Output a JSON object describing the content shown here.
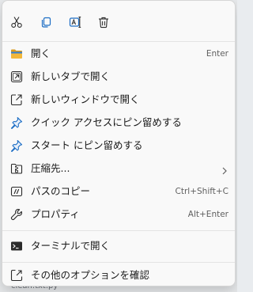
{
  "toolbar": {
    "cut_icon": "scissors-icon",
    "copy_icon": "copy-icon",
    "rename_icon": "rename-icon",
    "delete_icon": "trash-icon"
  },
  "items": [
    {
      "label": "開く",
      "shortcut": "Enter",
      "icon": "folder-icon"
    },
    {
      "label": "新しいタブで開く",
      "shortcut": "",
      "icon": "open-new-tab-icon"
    },
    {
      "label": "新しいウィンドウで開く",
      "shortcut": "",
      "icon": "open-new-window-icon"
    },
    {
      "label": "クイック アクセスにピン留めする",
      "shortcut": "",
      "icon": "pin-icon"
    },
    {
      "label": "スタート にピン留めする",
      "shortcut": "",
      "icon": "pin-icon"
    },
    {
      "label": "圧縮先...",
      "shortcut": "",
      "icon": "zip-folder-icon",
      "submenu": true
    },
    {
      "label": "パスのコピー",
      "shortcut": "Ctrl+Shift+C",
      "icon": "copy-path-icon"
    },
    {
      "label": "プロパティ",
      "shortcut": "Alt+Enter",
      "icon": "wrench-icon"
    },
    {
      "label": "ターミナルで開く",
      "shortcut": "",
      "icon": "terminal-icon"
    },
    {
      "label": "その他のオプションを確認",
      "shortcut": "",
      "icon": "more-options-icon"
    }
  ],
  "background": {
    "file_label": "clean.txt.py"
  },
  "colors": {
    "accent": "#1f6fc5",
    "folder_yellow": "#f0b429",
    "menu_bg": "#f9f9f9",
    "text": "#1a1a1a",
    "shortcut_text": "#5f5f5f"
  }
}
